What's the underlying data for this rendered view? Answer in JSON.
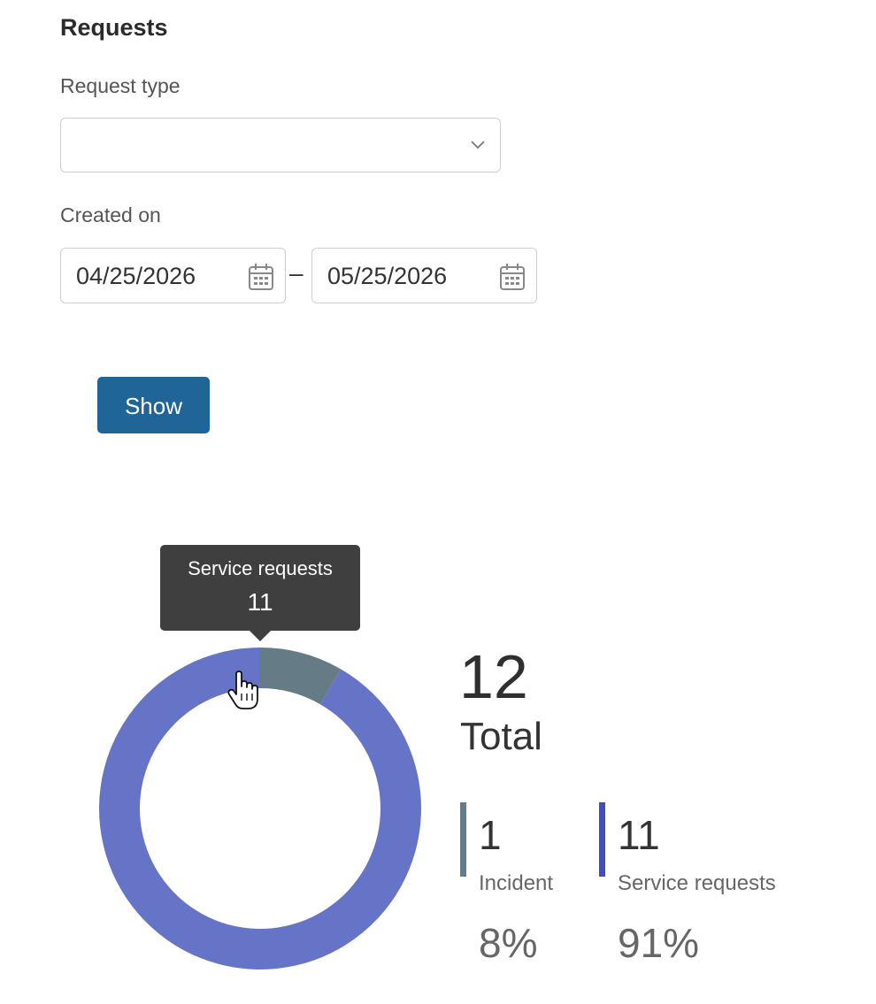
{
  "section_title": "Requests",
  "request_type": {
    "label": "Request type",
    "value": ""
  },
  "created_on": {
    "label": "Created on",
    "from": "04/25/2026",
    "separator": "–",
    "to": "05/25/2026"
  },
  "show_button": "Show",
  "tooltip": {
    "name": "Service requests",
    "value": "11"
  },
  "summary": {
    "total_value": "12",
    "total_label": "Total"
  },
  "legend": [
    {
      "value": "1",
      "name": "Incident",
      "percent": "8%",
      "color": "#657c86"
    },
    {
      "value": "11",
      "name": "Service requests",
      "percent": "91%",
      "color": "#3f4fbf"
    }
  ],
  "chart_data": {
    "type": "pie",
    "subtype": "donut",
    "total": 12,
    "series": [
      {
        "name": "Incident",
        "value": 1,
        "color": "#657c86"
      },
      {
        "name": "Service requests",
        "value": 11,
        "color": "#6674c7"
      }
    ]
  },
  "icons": {
    "dropdown": "chevron-down-icon",
    "date_picker": "calendar-icon",
    "pointer": "hand-pointer-icon"
  }
}
